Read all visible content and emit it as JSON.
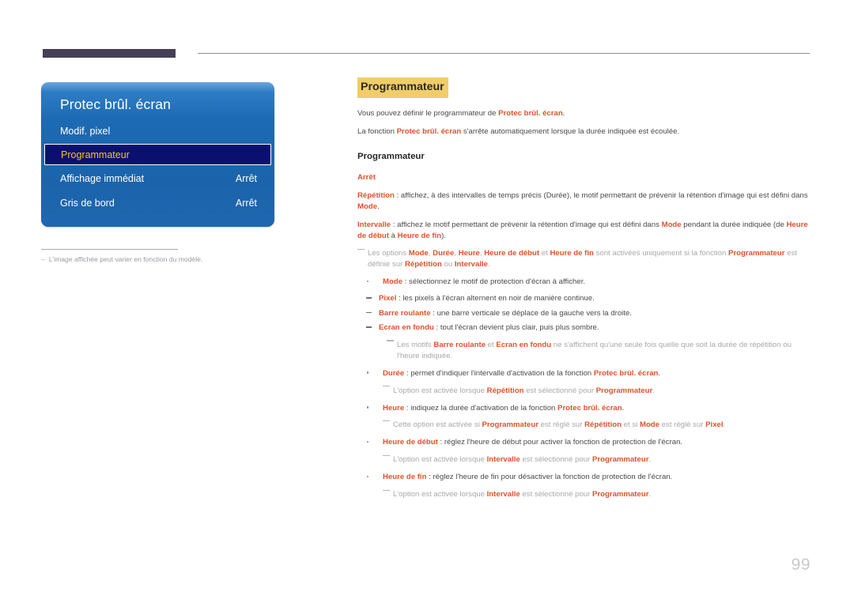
{
  "page": {
    "number": "99"
  },
  "header": {
    "bar_color": "#454055",
    "rule_color": "#8e8e96"
  },
  "osd": {
    "title": "Protec brûl. écran",
    "rows": [
      {
        "label": "Modif. pixel",
        "value": "",
        "selected": false
      },
      {
        "label": "Programmateur",
        "value": "",
        "selected": true
      },
      {
        "label": "Affichage immédiat",
        "value": "Arrêt",
        "selected": false
      },
      {
        "label": "Gris de bord",
        "value": "Arrêt",
        "selected": false
      }
    ],
    "selected_text_color": "#f5c518",
    "selected_bg_color": "#0b1070",
    "panel_color": "#1d6ab4"
  },
  "figure_note": {
    "dash": "–",
    "text": "L'image affichée peut varier en fonction du modèle."
  },
  "content": {
    "title": "Programmateur",
    "title_highlight_color": "#f0cd69",
    "accent_color": "#e0512c",
    "intro": [
      {
        "parts": [
          {
            "t": "Vous pouvez définir le programmateur de ",
            "s": "n"
          },
          {
            "t": "Protec brûl. écran",
            "s": "a"
          },
          {
            "t": ".",
            "s": "n"
          }
        ]
      },
      {
        "parts": [
          {
            "t": "La fonction ",
            "s": "n"
          },
          {
            "t": "Protec brûl. écran",
            "s": "a"
          },
          {
            "t": " s'arrête automatiquement lorsque la durée indiquée est écoulée.",
            "s": "n"
          }
        ]
      }
    ],
    "subhead": "Programmateur",
    "options": [
      {
        "parts": [
          {
            "t": "Arrêt",
            "s": "a"
          }
        ]
      },
      {
        "parts": [
          {
            "t": "Répétition",
            "s": "a"
          },
          {
            "t": " : affichez, à des intervalles de temps précis (Durée), le motif permettant de prévenir la rétention d'image qui est défini dans ",
            "s": "n"
          },
          {
            "t": "Mode",
            "s": "a"
          },
          {
            "t": ".",
            "s": "n"
          }
        ]
      },
      {
        "parts": [
          {
            "t": "Intervalle",
            "s": "a"
          },
          {
            "t": " : affichez le motif permettant de prévenir la rétention d'image qui est défini dans ",
            "s": "n"
          },
          {
            "t": "Mode",
            "s": "a"
          },
          {
            "t": " pendant la durée indiquée (de ",
            "s": "n"
          },
          {
            "t": "Heure de début",
            "s": "a"
          },
          {
            "t": " à ",
            "s": "n"
          },
          {
            "t": "Heure de fin",
            "s": "a"
          },
          {
            "t": ").",
            "s": "n"
          }
        ]
      }
    ],
    "top_note": {
      "parts": [
        {
          "t": "Les options ",
          "s": "m"
        },
        {
          "t": "Mode",
          "s": "a"
        },
        {
          "t": ", ",
          "s": "m"
        },
        {
          "t": "Durée",
          "s": "a"
        },
        {
          "t": ", ",
          "s": "m"
        },
        {
          "t": "Heure",
          "s": "a"
        },
        {
          "t": ", ",
          "s": "m"
        },
        {
          "t": "Heure de début",
          "s": "a"
        },
        {
          "t": " et ",
          "s": "m"
        },
        {
          "t": "Heure de fin",
          "s": "a"
        },
        {
          "t": " sont activées uniquement si la fonction ",
          "s": "m"
        },
        {
          "t": "Programmateur",
          "s": "a"
        },
        {
          "t": " est définie sur ",
          "s": "m"
        },
        {
          "t": "Répétition",
          "s": "a"
        },
        {
          "t": " ou ",
          "s": "m"
        },
        {
          "t": "Intervalle",
          "s": "a"
        },
        {
          "t": ".",
          "s": "m"
        }
      ]
    },
    "bullets": [
      {
        "parts": [
          {
            "t": "Mode",
            "s": "a"
          },
          {
            "t": " : sélectionnez le motif de protection d'écran à afficher.",
            "s": "n"
          }
        ],
        "sub": [
          {
            "parts": [
              {
                "t": "Pixel",
                "s": "a"
              },
              {
                "t": " : les pixels à l'écran alternent en noir de manière continue.",
                "s": "n"
              }
            ]
          },
          {
            "parts": [
              {
                "t": "Barre roulante",
                "s": "a"
              },
              {
                "t": " : une barre verticale se déplace de la gauche vers la droite.",
                "s": "n"
              }
            ]
          },
          {
            "parts": [
              {
                "t": "Ecran en fondu",
                "s": "a"
              },
              {
                "t": " : tout l'écran devient plus clair, puis plus sombre.",
                "s": "n"
              }
            ]
          }
        ],
        "sub_note": {
          "parts": [
            {
              "t": "Les motifs ",
              "s": "m"
            },
            {
              "t": "Barre roulante",
              "s": "a"
            },
            {
              "t": " et ",
              "s": "m"
            },
            {
              "t": "Ecran en fondu",
              "s": "a"
            },
            {
              "t": " ne s'affichent qu'une seule fois quelle que soit la durée de répétition ou l'heure indiquée.",
              "s": "m"
            }
          ]
        }
      },
      {
        "parts": [
          {
            "t": "Durée",
            "s": "a"
          },
          {
            "t": " : permet d'indiquer l'intervalle d'activation de la fonction ",
            "s": "n"
          },
          {
            "t": "Protec brûl. écran",
            "s": "a"
          },
          {
            "t": ".",
            "s": "n"
          }
        ],
        "note": {
          "parts": [
            {
              "t": "L'option est activée lorsque ",
              "s": "m"
            },
            {
              "t": "Répétition",
              "s": "a"
            },
            {
              "t": " est sélectionné pour ",
              "s": "m"
            },
            {
              "t": "Programmateur",
              "s": "a"
            },
            {
              "t": ".",
              "s": "m"
            }
          ]
        }
      },
      {
        "parts": [
          {
            "t": "Heure",
            "s": "a"
          },
          {
            "t": " : indiquez la durée d'activation de la fonction ",
            "s": "n"
          },
          {
            "t": "Protec brûl. écran",
            "s": "a"
          },
          {
            "t": ".",
            "s": "n"
          }
        ],
        "note": {
          "parts": [
            {
              "t": "Cette option est activée si ",
              "s": "m"
            },
            {
              "t": "Programmateur",
              "s": "a"
            },
            {
              "t": " est réglé sur ",
              "s": "m"
            },
            {
              "t": "Répétition",
              "s": "a"
            },
            {
              "t": " et si ",
              "s": "m"
            },
            {
              "t": "Mode",
              "s": "a"
            },
            {
              "t": " est réglé sur ",
              "s": "m"
            },
            {
              "t": "Pixel",
              "s": "a"
            },
            {
              "t": ".",
              "s": "m"
            }
          ]
        }
      },
      {
        "parts": [
          {
            "t": "Heure de début",
            "s": "a"
          },
          {
            "t": " : réglez l'heure de début pour activer la fonction de protection de l'écran.",
            "s": "n"
          }
        ],
        "note": {
          "parts": [
            {
              "t": "L'option est activée lorsque ",
              "s": "m"
            },
            {
              "t": "Intervalle",
              "s": "a"
            },
            {
              "t": " est sélectionné pour ",
              "s": "m"
            },
            {
              "t": "Programmateur",
              "s": "a"
            },
            {
              "t": ".",
              "s": "m"
            }
          ]
        }
      },
      {
        "parts": [
          {
            "t": "Heure de fin",
            "s": "a"
          },
          {
            "t": " : réglez l'heure de fin pour désactiver la fonction de protection de l'écran.",
            "s": "n"
          }
        ],
        "note": {
          "parts": [
            {
              "t": "L'option est activée lorsque ",
              "s": "m"
            },
            {
              "t": "Intervalle",
              "s": "a"
            },
            {
              "t": " est sélectionné pour ",
              "s": "m"
            },
            {
              "t": "Programmateur",
              "s": "a"
            },
            {
              "t": ".",
              "s": "m"
            }
          ]
        }
      }
    ]
  }
}
